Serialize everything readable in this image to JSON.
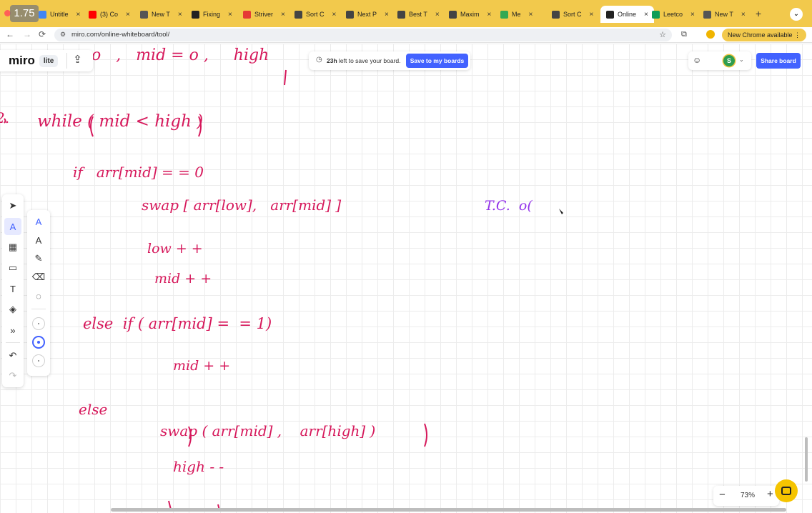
{
  "browser": {
    "speed_badge": "1.75",
    "tabs": [
      {
        "label": "Untitle",
        "color": "#4285f4"
      },
      {
        "label": "(3) Co",
        "color": "#ff0000"
      },
      {
        "label": "New T",
        "color": "#555555"
      },
      {
        "label": "Fixing",
        "color": "#222222"
      },
      {
        "label": "Striver",
        "color": "#e53935"
      },
      {
        "label": "Sort C",
        "color": "#444444"
      },
      {
        "label": "Next P",
        "color": "#444444"
      },
      {
        "label": "Best T",
        "color": "#444444"
      },
      {
        "label": "Maxim",
        "color": "#444444"
      },
      {
        "label": "Me",
        "color": "#34a853"
      },
      {
        "label": "Sort C",
        "color": "#444444"
      },
      {
        "label": "Online",
        "color": "#222222",
        "active": true
      },
      {
        "label": "Leetco",
        "color": "#0f9d58"
      },
      {
        "label": "New T",
        "color": "#555555"
      }
    ],
    "new_tab": "+",
    "url": "miro.com/online-whiteboard/tool/",
    "new_chrome_label": "New Chrome available"
  },
  "miro": {
    "logo": "miro",
    "badge": "lite",
    "save_time": "23h",
    "save_text": " left to save your board.",
    "save_button": "Save to my boards",
    "avatar_letter": "S",
    "share_button": "Share board",
    "zoom": "73%",
    "brand_color": "#4262ff",
    "ink_color": "#d6185b"
  },
  "board": {
    "line_top": "o   ,   mid = o ,     high",
    "line_while": "while ( mid < high )",
    "line_index": "2.",
    "line_if": "if   arr[mid] = = 0",
    "line_swap1": "swap [ arr[low],   arr[mid] ]",
    "line_tc": "T.C.  o(",
    "line_low": "low + +",
    "line_mid1": "mid + +",
    "line_elseif": "else  if ( arr[mid] =  = 1)",
    "line_mid2": "mid + +",
    "line_else": "else",
    "line_swap2": "swap ( arr[mid] ,    arr[high] )",
    "line_high": "high - -"
  },
  "icons": {
    "back": "←",
    "forward": "→",
    "reload": "⟳",
    "site": "⚙",
    "star": "☆",
    "extensions": "⧉",
    "upload": "⇪",
    "clock": "◷",
    "reactions": "☺",
    "chevron": "⌄",
    "select": "➤",
    "pen": "A",
    "templates": "▦",
    "sticky": "▭",
    "text": "T",
    "shapes": "◈",
    "more": "»",
    "undo": "↶",
    "redo": "↷",
    "pen_a": "A",
    "highlighter": "A",
    "smart_draw": "✎",
    "eraser": "⌫",
    "lasso": "◌",
    "zoom_out": "−",
    "zoom_in": "+"
  }
}
